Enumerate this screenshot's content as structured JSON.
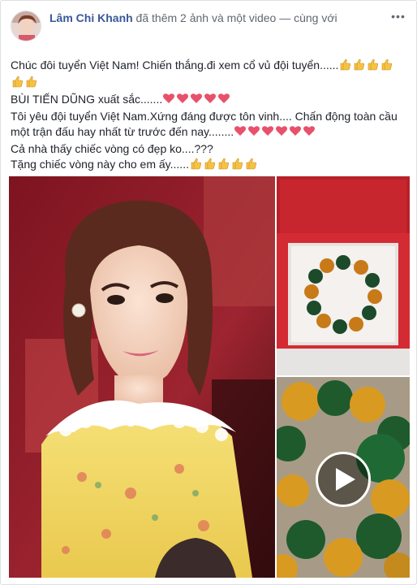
{
  "post": {
    "author": "Lâm Chi Khanh",
    "action": " đã thêm 2 ảnh và một video — cùng với",
    "more_icon": "ellipsis-icon",
    "message_lines": [
      "Chúc đôi tuyển Việt Nam! Chiến thắng.đi xem cổ vủ đội tuyển......",
      "BÙI TIẾN DŨNG xuất sắc.......",
      "Tôi yêu đội tuyển Việt Nam.Xứng đáng được tôn vinh.... Chấn động toàn cầu một trận đấu hay nhất từ trước đến nay........",
      "Cả nhà thấy chiếc vòng có đẹp ko....???",
      "Tặng chiếc vòng này cho em ấy......"
    ],
    "emoji_icons": [
      "thumb-icon",
      "heart-icon"
    ],
    "media": {
      "main_photo": "woman-portrait-photo",
      "side_photo": "bracelet-box-photo",
      "video": "bracelet-video-thumbnail",
      "play_icon": "play-icon"
    }
  }
}
